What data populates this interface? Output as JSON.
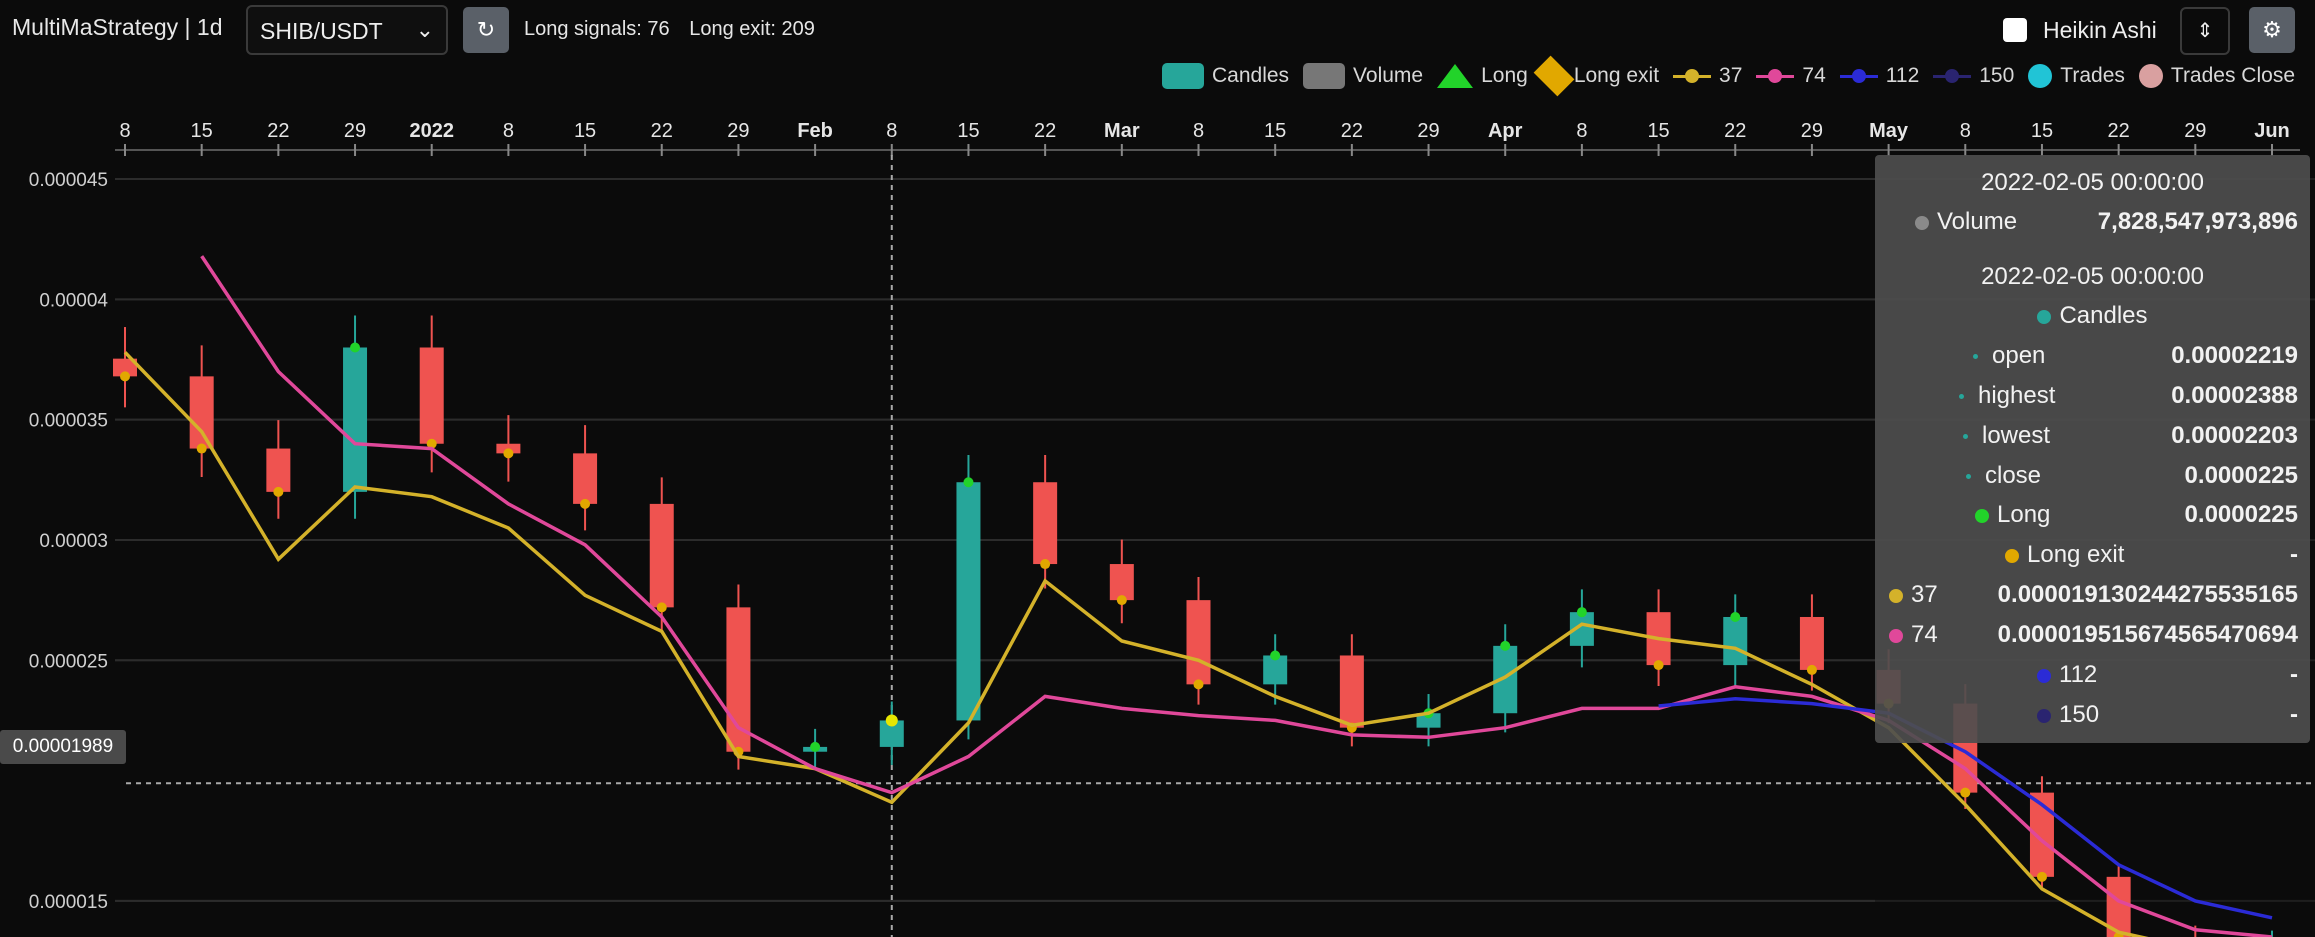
{
  "app": {
    "title": "MultiMaStrategy | 1d"
  },
  "pair": {
    "value": "SHIB/USDT"
  },
  "signals": {
    "long": "Long signals: 76",
    "long_exit": "Long exit: 209"
  },
  "heikin": {
    "label": "Heikin Ashi"
  },
  "icons": {
    "refresh": "refresh-icon",
    "gear": "gear-icon",
    "spinner": "up-down-spinner-icon",
    "chevron": "chevron-down-icon"
  },
  "legend": [
    {
      "label": "Candles",
      "color": "#26a69a"
    },
    {
      "label": "Volume",
      "color": "#777777"
    },
    {
      "label": "Long",
      "color": "#22d32a"
    },
    {
      "label": "Long exit",
      "color": "#e1a800"
    },
    {
      "label": "37",
      "color": "#d4b22a"
    },
    {
      "label": "74",
      "color": "#e0489a"
    },
    {
      "label": "112",
      "color": "#2b2bd6"
    },
    {
      "label": "150",
      "color": "#2a2470"
    },
    {
      "label": "Trades",
      "color": "#21c4d6"
    },
    {
      "label": "Trades Close",
      "color": "#d9a0a0"
    }
  ],
  "crosshair": {
    "price_label": "0.00001989",
    "date": "2022-02-05"
  },
  "tooltip": {
    "date1": "2022-02-05 00:00:00",
    "volume_label": "Volume",
    "volume_value": "7,828,547,973,896",
    "date2": "2022-02-05 00:00:00",
    "candles_label": "Candles",
    "open_label": "open",
    "open_value": "0.00002219",
    "highest_label": "highest",
    "highest_value": "0.00002388",
    "lowest_label": "lowest",
    "lowest_value": "0.00002203",
    "close_label": "close",
    "close_value": "0.0000225",
    "long_label": "Long",
    "long_value": "0.0000225",
    "longexit_label": "Long exit",
    "longexit_value": "-",
    "ma37_label": "37",
    "ma37_value": "0.000019130244275535165",
    "ma74_label": "74",
    "ma74_value": "0.000019515674565470694",
    "ma112_label": "112",
    "ma112_value": "-",
    "ma150_label": "150",
    "ma150_value": "-"
  },
  "chart_data": {
    "type": "line",
    "title": "",
    "x_ticks": [
      "8",
      "15",
      "22",
      "29",
      "2022",
      "8",
      "15",
      "22",
      "29",
      "Feb",
      "8",
      "15",
      "22",
      "Mar",
      "8",
      "15",
      "22",
      "29",
      "Apr",
      "8",
      "15",
      "22",
      "29",
      "May",
      "8",
      "15",
      "22",
      "29",
      "Jun"
    ],
    "y_ticks": [
      "0.000045",
      "0.00004",
      "0.000035",
      "0.00003",
      "0.000025",
      "0.000015"
    ],
    "ylim": [
      1.35e-05,
      4.6e-05
    ],
    "x": [
      "2021-12-01",
      "2021-12-08",
      "2021-12-15",
      "2021-12-22",
      "2021-12-29",
      "2022-01-05",
      "2022-01-12",
      "2022-01-19",
      "2022-01-26",
      "2022-02-02",
      "2022-02-05",
      "2022-02-09",
      "2022-02-16",
      "2022-02-23",
      "2022-03-02",
      "2022-03-09",
      "2022-03-16",
      "2022-03-23",
      "2022-03-30",
      "2022-04-06",
      "2022-04-13",
      "2022-04-20",
      "2022-04-27",
      "2022-05-04",
      "2022-05-11",
      "2022-05-18",
      "2022-05-25",
      "2022-06-01",
      "2022-06-05"
    ],
    "series": [
      {
        "name": "Candles",
        "values": [
          3.68e-05,
          3.38e-05,
          3.2e-05,
          3.8e-05,
          3.4e-05,
          3.36e-05,
          3.15e-05,
          2.72e-05,
          2.12e-05,
          2.14e-05,
          2.25e-05,
          3.24e-05,
          2.9e-05,
          2.75e-05,
          2.4e-05,
          2.52e-05,
          2.22e-05,
          2.28e-05,
          2.56e-05,
          2.7e-05,
          2.48e-05,
          2.68e-05,
          2.46e-05,
          2.32e-05,
          1.95e-05,
          1.6e-05,
          1.35e-05,
          1.3e-05,
          1.33e-05
        ]
      },
      {
        "name": "37",
        "values": [
          3.78e-05,
          3.45e-05,
          2.92e-05,
          3.22e-05,
          3.18e-05,
          3.05e-05,
          2.77e-05,
          2.62e-05,
          2.1e-05,
          2.05e-05,
          1.91e-05,
          2.24e-05,
          2.83e-05,
          2.58e-05,
          2.5e-05,
          2.35e-05,
          2.23e-05,
          2.28e-05,
          2.43e-05,
          2.65e-05,
          2.59e-05,
          2.55e-05,
          2.4e-05,
          2.22e-05,
          1.9e-05,
          1.55e-05,
          1.37e-05,
          1.3e-05,
          1.3e-05
        ]
      },
      {
        "name": "74",
        "values": [
          null,
          4.18e-05,
          3.7e-05,
          3.4e-05,
          3.38e-05,
          3.15e-05,
          2.98e-05,
          2.68e-05,
          2.22e-05,
          2.05e-05,
          1.95e-05,
          2.1e-05,
          2.35e-05,
          2.3e-05,
          2.27e-05,
          2.25e-05,
          2.19e-05,
          2.18e-05,
          2.22e-05,
          2.3e-05,
          2.3e-05,
          2.39e-05,
          2.35e-05,
          2.25e-05,
          2.05e-05,
          1.75e-05,
          1.5e-05,
          1.38e-05,
          1.35e-05
        ]
      },
      {
        "name": "112",
        "values": [
          null,
          null,
          null,
          null,
          null,
          null,
          null,
          null,
          null,
          null,
          null,
          null,
          null,
          null,
          null,
          null,
          null,
          null,
          null,
          null,
          2.31e-05,
          2.34e-05,
          2.32e-05,
          2.28e-05,
          2.12e-05,
          1.9e-05,
          1.65e-05,
          1.5e-05,
          1.43e-05
        ]
      }
    ],
    "legend_position": "top-right",
    "grid": true
  }
}
